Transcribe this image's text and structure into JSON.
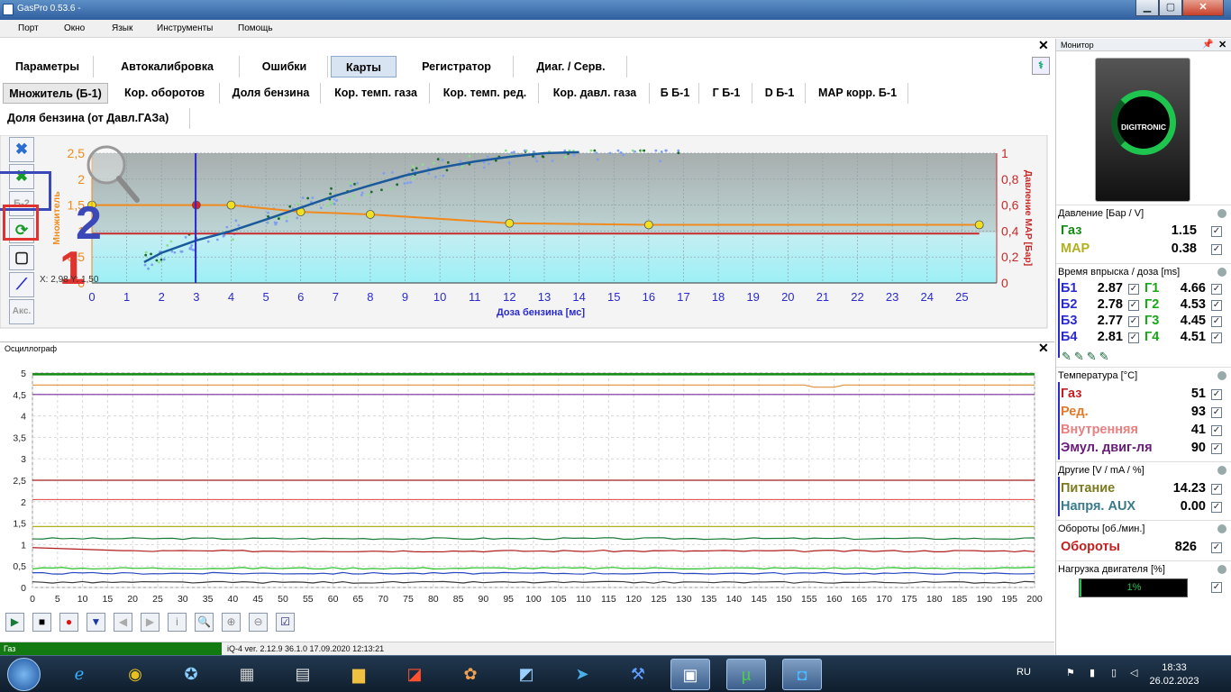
{
  "window": {
    "title": "GasPro 0.53.6 -"
  },
  "menu": [
    "Порт",
    "Окно",
    "Язык",
    "Инструменты",
    "Помощь"
  ],
  "tabs": [
    "Параметры",
    "Автокалибровка",
    "Ошибки",
    "Карты",
    "Регистратор",
    "Диаг. / Серв."
  ],
  "subtabs": [
    "Множитель (Б-1)",
    "Кор. оборотов",
    "Доля бензина",
    "Кор. темп. газа",
    "Кор. темп. ред.",
    "Кор. давл. газа",
    "Б Б-1",
    "Г Б-1",
    "D Б-1",
    "MAP корр. Б-1"
  ],
  "subtab3": "Доля бензина (от Давл.ГАЗа)",
  "toolbar": {
    "b2_label": "Б-2",
    "aks_label": "Акс."
  },
  "annotations": {
    "one": "1",
    "two": "2"
  },
  "coords": "X: 2,98  Y: 1,50",
  "map_colors": {
    "orange": "#f08a1e",
    "red": "#c62a2a",
    "blue": "#3333cc"
  },
  "chart_data": [
    {
      "type": "line",
      "title": "",
      "xlabel": "Доза бензина [мс]",
      "ylabel": "Множитель",
      "ylabel_right": "Давление MAP [Бар]",
      "xlim": [
        0,
        26
      ],
      "ylim": [
        0,
        2.5
      ],
      "ylim_right": [
        0,
        1
      ],
      "x_ticks": [
        0,
        1,
        2,
        3,
        4,
        5,
        6,
        7,
        8,
        9,
        10,
        11,
        12,
        13,
        14,
        15,
        16,
        17,
        18,
        19,
        20,
        21,
        22,
        23,
        24,
        25
      ],
      "y_ticks": [
        "0",
        "0,5",
        "1",
        "1,5",
        "2",
        "2,5"
      ],
      "y_ticks_right": [
        "0",
        "0,2",
        "0,4",
        "0,6",
        "0,8",
        "1"
      ],
      "cursor_x": 2.98,
      "series": [
        {
          "name": "",
          "color": "#f08a1e",
          "points": [
            [
              0,
              1.5
            ],
            [
              3,
              1.5
            ],
            [
              4,
              1.5
            ],
            [
              6,
              1.37
            ],
            [
              8,
              1.32
            ],
            [
              12,
              1.15
            ],
            [
              16,
              1.12
            ],
            [
              25.5,
              1.12
            ]
          ]
        },
        {
          "name": "",
          "color": "#c62a2a",
          "points": [
            [
              0,
              0.95
            ],
            [
              25.5,
              0.95
            ]
          ]
        },
        {
          "name": "",
          "color": "#1a5a9a",
          "points": [
            [
              1.5,
              0.4
            ],
            [
              2,
              0.58
            ],
            [
              3,
              0.82
            ],
            [
              4,
              1.0
            ],
            [
              5,
              1.22
            ],
            [
              6,
              1.45
            ],
            [
              7,
              1.68
            ],
            [
              8,
              1.88
            ],
            [
              9,
              2.07
            ],
            [
              10,
              2.22
            ],
            [
              11,
              2.34
            ],
            [
              12,
              2.43
            ],
            [
              13,
              2.5
            ],
            [
              14,
              2.52
            ]
          ]
        }
      ]
    },
    {
      "type": "line",
      "title": "",
      "xlim": [
        0,
        200
      ],
      "ylim": [
        0,
        5
      ],
      "x_ticks": [
        0,
        5,
        10,
        15,
        20,
        25,
        30,
        35,
        40,
        45,
        50,
        55,
        60,
        65,
        70,
        75,
        80,
        85,
        90,
        95,
        100,
        105,
        110,
        115,
        120,
        125,
        130,
        135,
        140,
        145,
        150,
        155,
        160,
        165,
        170,
        175,
        180,
        185,
        190,
        195,
        200
      ],
      "y_ticks": [
        "0",
        "0,5",
        "1",
        "1,5",
        "2",
        "2,5",
        "3",
        "3,5",
        "4",
        "4,5",
        "5"
      ],
      "series": [
        {
          "name": "",
          "color": "#138a13",
          "values": [
            4.97
          ]
        },
        {
          "name": "",
          "color": "#e0903a",
          "values": [
            4.72
          ]
        },
        {
          "name": "",
          "color": "#7a2e9a",
          "values": [
            4.5
          ]
        },
        {
          "name": "",
          "color": "#a01e1e",
          "values": [
            2.5
          ]
        },
        {
          "name": "",
          "color": "#e05a5a",
          "values": [
            2.05
          ]
        },
        {
          "name": "",
          "color": "#b0b020",
          "values": [
            1.42
          ]
        },
        {
          "name": "",
          "color": "#1b7a3a",
          "values": [
            1.14
          ]
        },
        {
          "name": "",
          "color": "#b01e1e",
          "values": [
            0.85
          ]
        },
        {
          "name": "",
          "color": "#28c028",
          "values": [
            0.45
          ]
        },
        {
          "name": "",
          "color": "#2848c0",
          "values": [
            0.33
          ]
        },
        {
          "name": "",
          "color": "#3a3a3a",
          "values": [
            0.12
          ]
        }
      ]
    }
  ],
  "playbar": [
    "▶",
    "■",
    "●",
    "▼",
    "◀",
    "▶",
    "i",
    "🔍",
    "⊕",
    "⊖",
    "☑"
  ],
  "status": {
    "mode": "Газ",
    "version": "iQ-4   ver. 2.12.9   36.1.0     17.09.2020 12:13:21"
  },
  "monitor": {
    "title": "Монитор",
    "logo": "DIGITRONIC",
    "pressure_title": "Давление [Бар / V]",
    "gas": {
      "label": "Газ",
      "value": "1.15"
    },
    "map": {
      "label": "MAP",
      "value": "0.38"
    },
    "inject_title": "Время впрыска / доза [ms]",
    "inject": [
      {
        "b": "Б1",
        "bv": "2.87",
        "g": "Г1",
        "gv": "4.66"
      },
      {
        "b": "Б2",
        "bv": "2.78",
        "g": "Г2",
        "gv": "4.53"
      },
      {
        "b": "Б3",
        "bv": "2.77",
        "g": "Г3",
        "gv": "4.45"
      },
      {
        "b": "Б4",
        "bv": "2.81",
        "g": "Г4",
        "gv": "4.51"
      }
    ],
    "temp_title": "Температура [°C]",
    "temps": [
      {
        "label": "Газ",
        "value": "51",
        "color": "#c41e1e"
      },
      {
        "label": "Ред.",
        "value": "93",
        "color": "#e07a2a"
      },
      {
        "label": "Внутренняя",
        "value": "41",
        "color": "#e88080"
      },
      {
        "label": "Эмул. двиг-ля",
        "value": "90",
        "color": "#6a1a7a"
      }
    ],
    "other_title": "Другие [V / mA / %]",
    "power": {
      "label": "Питание",
      "value": "14.23"
    },
    "aux": {
      "label": "Напря. AUX",
      "value": "0.00"
    },
    "rpm_title": "Обороты [об./мин.]",
    "rpm": {
      "label": "Обороты",
      "value": "826"
    },
    "load_title": "Нагрузка двигателя [%]",
    "load": {
      "value": "1%",
      "fraction": 0.01
    }
  },
  "taskbar": {
    "lang": "RU",
    "time": "18:33",
    "date": "26.02.2023"
  }
}
